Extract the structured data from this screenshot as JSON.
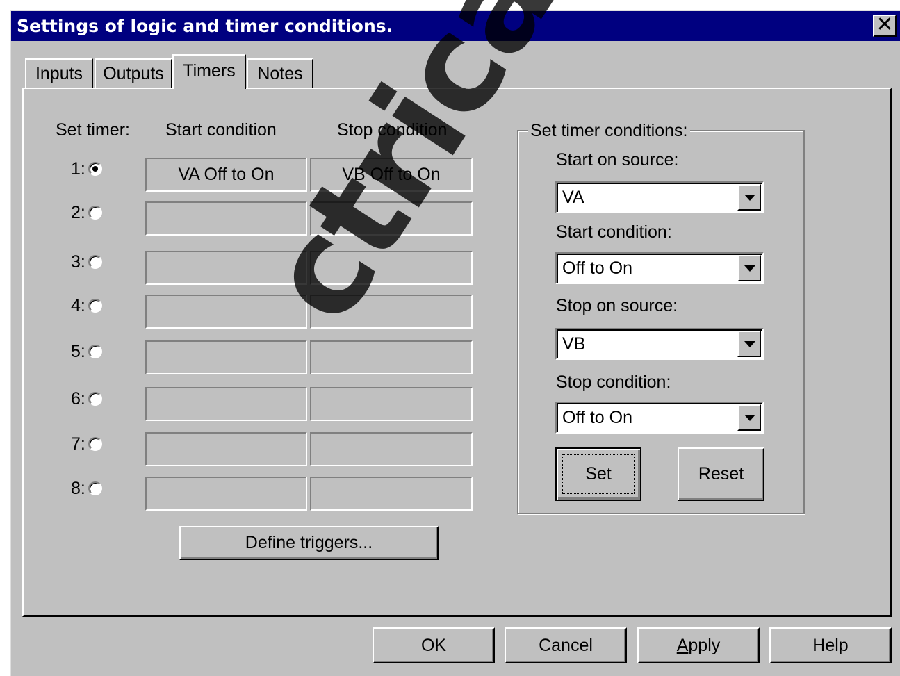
{
  "window": {
    "title": "Settings of logic and timer conditions.",
    "close_glyph": "✕"
  },
  "tabs": [
    {
      "label": "Inputs"
    },
    {
      "label": "Outputs"
    },
    {
      "label": "Timers"
    },
    {
      "label": "Notes"
    }
  ],
  "active_tab": "Timers",
  "table": {
    "headers": {
      "set_timer": "Set timer:",
      "start": "Start condition",
      "stop": "Stop condition"
    },
    "rows": [
      {
        "label": "1:",
        "selected": true,
        "start": "VA Off to On",
        "stop": "VB Off to On"
      },
      {
        "label": "2:",
        "selected": false,
        "start": "",
        "stop": ""
      },
      {
        "label": "3:",
        "selected": false,
        "start": "",
        "stop": ""
      },
      {
        "label": "4:",
        "selected": false,
        "start": "",
        "stop": ""
      },
      {
        "label": "5:",
        "selected": false,
        "start": "",
        "stop": ""
      },
      {
        "label": "6:",
        "selected": false,
        "start": "",
        "stop": ""
      },
      {
        "label": "7:",
        "selected": false,
        "start": "",
        "stop": ""
      },
      {
        "label": "8:",
        "selected": false,
        "start": "",
        "stop": ""
      }
    ]
  },
  "define_triggers_label": "Define triggers...",
  "conditions": {
    "group_title": "Set timer conditions:",
    "start_source_label": "Start on source:",
    "start_source_value": "VA",
    "start_condition_label": "Start condition:",
    "start_condition_value": "Off to On",
    "stop_source_label": "Stop on source:",
    "stop_source_value": "VB",
    "stop_condition_label": "Stop condition:",
    "stop_condition_value": "Off to On",
    "set_label": "Set",
    "reset_label": "Reset"
  },
  "footer": {
    "ok_label": "OK",
    "cancel_label": "Cancel",
    "apply_label_first": "A",
    "apply_label_rest": "pply",
    "help_label": "Help"
  },
  "watermark": "ctricalPartManuals"
}
